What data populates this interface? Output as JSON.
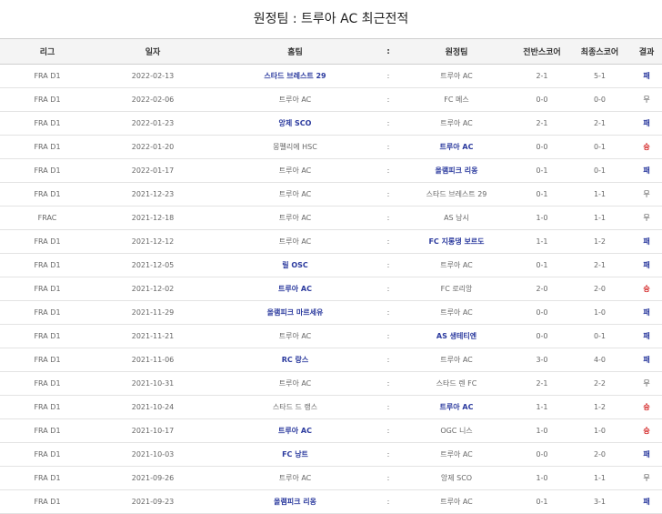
{
  "title": "원정팀 : 트루아 AC 최근전적",
  "headers": {
    "league": "리그",
    "date": "일자",
    "home": "홈팀",
    "sep": ":",
    "away": "원정팀",
    "ht": "전반스코어",
    "ft": "최종스코어",
    "result": "결과"
  },
  "colors": {
    "team_highlight": "#2b3a9e",
    "win": "#d21f1f",
    "header_bg": "#f4f4f4"
  },
  "rows": [
    {
      "league": "FRA D1",
      "date": "2022-02-13",
      "home": "스타드 브레스트 29",
      "sep": ":",
      "away": "트루아 AC",
      "ht": "2-1",
      "ft": "5-1",
      "result": "패",
      "winner": "home",
      "res": "loss"
    },
    {
      "league": "FRA D1",
      "date": "2022-02-06",
      "home": "트루아 AC",
      "sep": ":",
      "away": "FC 메스",
      "ht": "0-0",
      "ft": "0-0",
      "result": "무",
      "winner": "",
      "res": "draw"
    },
    {
      "league": "FRA D1",
      "date": "2022-01-23",
      "home": "앙제 SCO",
      "sep": ":",
      "away": "트루아 AC",
      "ht": "2-1",
      "ft": "2-1",
      "result": "패",
      "winner": "home",
      "res": "loss"
    },
    {
      "league": "FRA D1",
      "date": "2022-01-20",
      "home": "몽펠리에 HSC",
      "sep": ":",
      "away": "트루아 AC",
      "ht": "0-0",
      "ft": "0-1",
      "result": "승",
      "winner": "away",
      "res": "win"
    },
    {
      "league": "FRA D1",
      "date": "2022-01-17",
      "home": "트루아 AC",
      "sep": ":",
      "away": "올램피크 리옹",
      "ht": "0-1",
      "ft": "0-1",
      "result": "패",
      "winner": "away",
      "res": "loss"
    },
    {
      "league": "FRA D1",
      "date": "2021-12-23",
      "home": "트루아 AC",
      "sep": ":",
      "away": "스타드 브레스트 29",
      "ht": "0-1",
      "ft": "1-1",
      "result": "무",
      "winner": "",
      "res": "draw"
    },
    {
      "league": "FRAC",
      "date": "2021-12-18",
      "home": "트루아 AC",
      "sep": ":",
      "away": "AS 낭시",
      "ht": "1-0",
      "ft": "1-1",
      "result": "무",
      "winner": "",
      "res": "draw"
    },
    {
      "league": "FRA D1",
      "date": "2021-12-12",
      "home": "트루아 AC",
      "sep": ":",
      "away": "FC 지롱댕 보르도",
      "ht": "1-1",
      "ft": "1-2",
      "result": "패",
      "winner": "away",
      "res": "loss"
    },
    {
      "league": "FRA D1",
      "date": "2021-12-05",
      "home": "릴 OSC",
      "sep": ":",
      "away": "트루아 AC",
      "ht": "0-1",
      "ft": "2-1",
      "result": "패",
      "winner": "home",
      "res": "loss"
    },
    {
      "league": "FRA D1",
      "date": "2021-12-02",
      "home": "트루아 AC",
      "sep": ":",
      "away": "FC 로리앙",
      "ht": "2-0",
      "ft": "2-0",
      "result": "승",
      "winner": "home",
      "res": "win"
    },
    {
      "league": "FRA D1",
      "date": "2021-11-29",
      "home": "올램피크 마르세유",
      "sep": ":",
      "away": "트루아 AC",
      "ht": "0-0",
      "ft": "1-0",
      "result": "패",
      "winner": "home",
      "res": "loss"
    },
    {
      "league": "FRA D1",
      "date": "2021-11-21",
      "home": "트루아 AC",
      "sep": ":",
      "away": "AS 생테티엔",
      "ht": "0-0",
      "ft": "0-1",
      "result": "패",
      "winner": "away",
      "res": "loss"
    },
    {
      "league": "FRA D1",
      "date": "2021-11-06",
      "home": "RC 랑스",
      "sep": ":",
      "away": "트루아 AC",
      "ht": "3-0",
      "ft": "4-0",
      "result": "패",
      "winner": "home",
      "res": "loss"
    },
    {
      "league": "FRA D1",
      "date": "2021-10-31",
      "home": "트루아 AC",
      "sep": ":",
      "away": "스타드 렌 FC",
      "ht": "2-1",
      "ft": "2-2",
      "result": "무",
      "winner": "",
      "res": "draw"
    },
    {
      "league": "FRA D1",
      "date": "2021-10-24",
      "home": "스타드 드 랭스",
      "sep": ":",
      "away": "트루아 AC",
      "ht": "1-1",
      "ft": "1-2",
      "result": "승",
      "winner": "away",
      "res": "win"
    },
    {
      "league": "FRA D1",
      "date": "2021-10-17",
      "home": "트루아 AC",
      "sep": ":",
      "away": "OGC 니스",
      "ht": "1-0",
      "ft": "1-0",
      "result": "승",
      "winner": "home",
      "res": "win"
    },
    {
      "league": "FRA D1",
      "date": "2021-10-03",
      "home": "FC 낭트",
      "sep": ":",
      "away": "트루아 AC",
      "ht": "0-0",
      "ft": "2-0",
      "result": "패",
      "winner": "home",
      "res": "loss"
    },
    {
      "league": "FRA D1",
      "date": "2021-09-26",
      "home": "트루아 AC",
      "sep": ":",
      "away": "앙제 SCO",
      "ht": "1-0",
      "ft": "1-1",
      "result": "무",
      "winner": "",
      "res": "draw"
    },
    {
      "league": "FRA D1",
      "date": "2021-09-23",
      "home": "올램피크 리옹",
      "sep": ":",
      "away": "트루아 AC",
      "ht": "0-1",
      "ft": "3-1",
      "result": "패",
      "winner": "home",
      "res": "loss"
    }
  ]
}
